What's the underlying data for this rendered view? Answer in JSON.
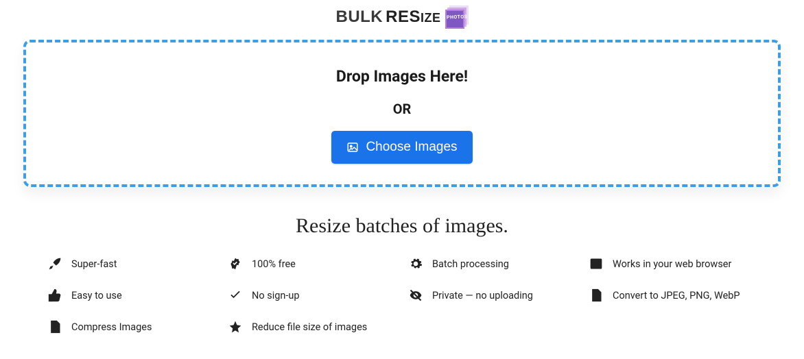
{
  "logo": {
    "word1": "BULK",
    "word2_big": "RES",
    "word2_sm": "IZE",
    "badge": "PHOTOS"
  },
  "dropzone": {
    "heading": "Drop Images Here!",
    "or": "OR",
    "button": "Choose Images"
  },
  "tagline": "Resize batches of images.",
  "features": [
    {
      "icon": "rocket",
      "label": "Super-fast"
    },
    {
      "icon": "badge",
      "label": "100% free"
    },
    {
      "icon": "gear",
      "label": "Batch processing"
    },
    {
      "icon": "browser",
      "label": "Works in your web browser"
    },
    {
      "icon": "thumb",
      "label": "Easy to use"
    },
    {
      "icon": "check",
      "label": "No sign-up"
    },
    {
      "icon": "eyeoff",
      "label": "Private — no uploading"
    },
    {
      "icon": "filecode",
      "label": "Convert to JPEG, PNG, WebP"
    },
    {
      "icon": "compress",
      "label": "Compress Images"
    },
    {
      "icon": "star",
      "label": "Reduce file size of images"
    }
  ]
}
